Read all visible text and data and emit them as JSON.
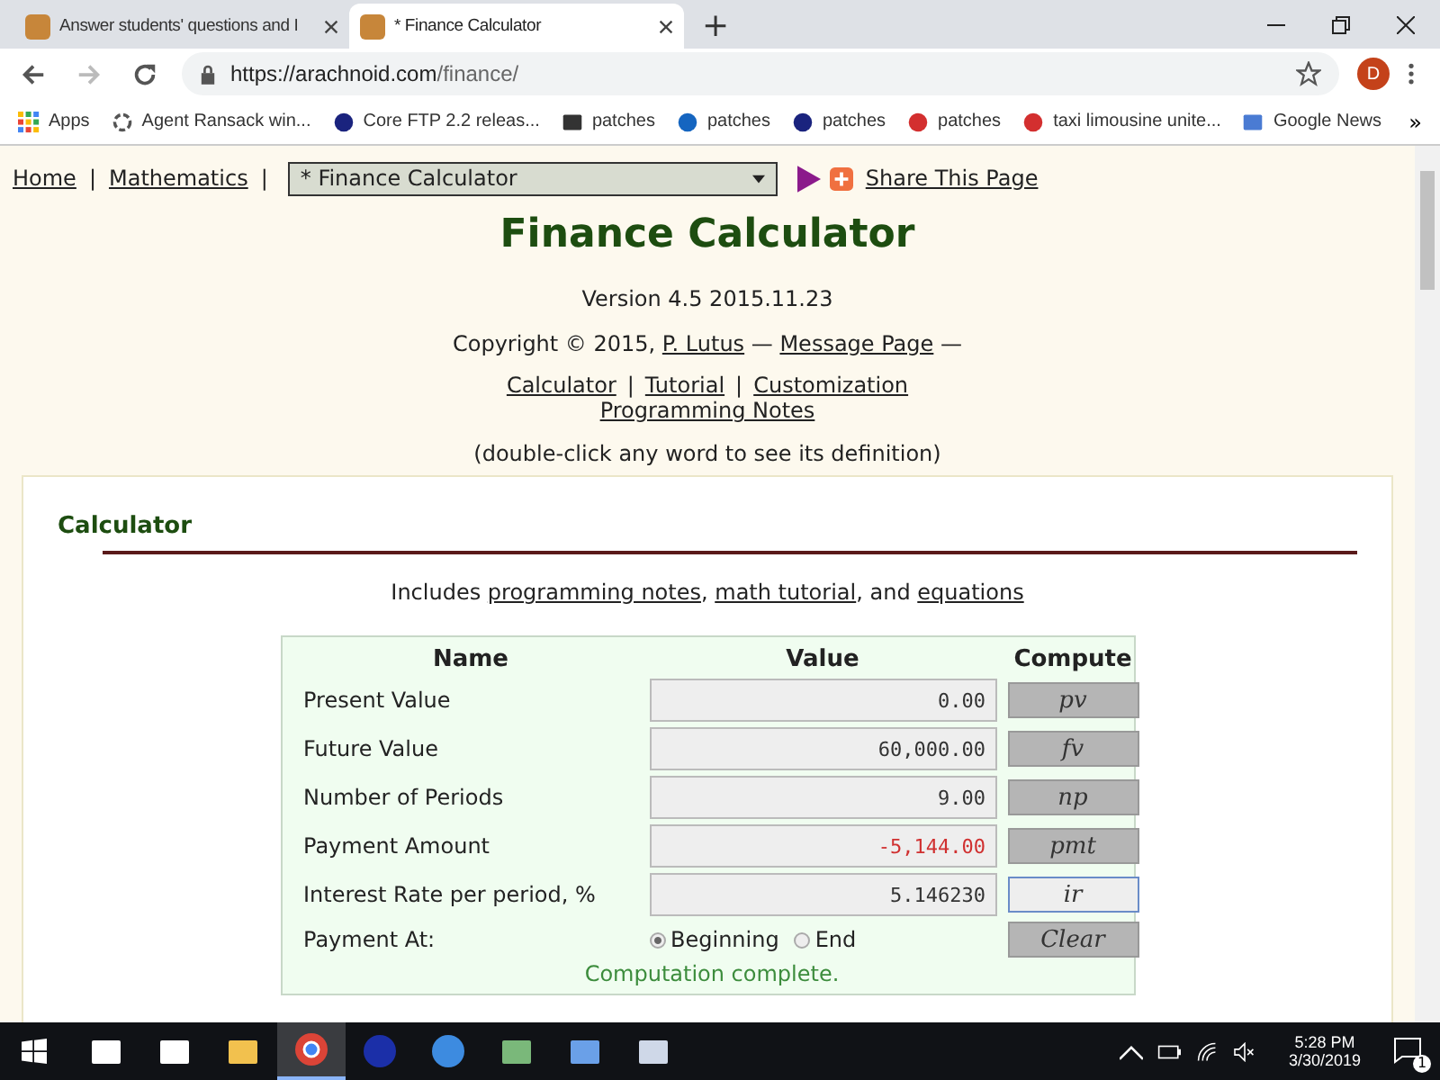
{
  "browser": {
    "tabs": [
      {
        "title": "Answer students' questions and I",
        "selected": false
      },
      {
        "title": "* Finance Calculator",
        "selected": true
      }
    ],
    "new_tab": "+",
    "url_host": "https://arachnoid.com",
    "url_path": "/finance/",
    "profile_initial": "D",
    "bookmarks": [
      {
        "label": "Apps",
        "kind": "grid"
      },
      {
        "label": "Agent Ransack win...",
        "kind": "ring"
      },
      {
        "label": "Core FTP 2.2 releas...",
        "kind": "disc"
      },
      {
        "label": "patches",
        "kind": "square"
      },
      {
        "label": "patches",
        "kind": "drop"
      },
      {
        "label": "patches",
        "kind": "disc"
      },
      {
        "label": "patches",
        "kind": "pin"
      },
      {
        "label": "taxi limousine unite...",
        "kind": "star"
      },
      {
        "label": "Google News",
        "kind": "news"
      }
    ],
    "more": "»"
  },
  "page": {
    "nav": {
      "links": [
        "Home",
        "Mathematics"
      ],
      "separator": "|",
      "dropdown": "* Finance Calculator",
      "share": "Share This Page"
    },
    "title": "Finance Calculator",
    "version": "Version 4.5 2015.11.23",
    "copyright": [
      {
        "text": "Copyright © 2015, ",
        "kind": "text"
      },
      {
        "text": "P. Lutus",
        "kind": "link"
      },
      {
        "text": " — ",
        "kind": "text"
      },
      {
        "text": "Message Page",
        "kind": "link"
      },
      {
        "text": " —",
        "kind": "text"
      }
    ],
    "doc_links": [
      "Calculator",
      "Tutorial",
      "Customization",
      "Programming Notes"
    ],
    "doc_separator": "|",
    "hint": "(double-click any word to see its definition)",
    "section": {
      "heading": "Calculator",
      "includes": [
        {
          "text": "Includes ",
          "kind": "text"
        },
        {
          "text": "programming notes",
          "kind": "link"
        },
        {
          "text": ", ",
          "kind": "text"
        },
        {
          "text": "math tutorial",
          "kind": "link"
        },
        {
          "text": ", and ",
          "kind": "text"
        },
        {
          "text": "equations",
          "kind": "link"
        }
      ],
      "calculator": {
        "columns": [
          "Name",
          "Value",
          "Compute"
        ],
        "rows": [
          {
            "name": "Present Value",
            "value": "0.00",
            "negative": false,
            "button": "pv",
            "focused": false
          },
          {
            "name": "Future Value",
            "value": "60,000.00",
            "negative": false,
            "button": "fv",
            "focused": false
          },
          {
            "name": "Number of Periods",
            "value": "9.00",
            "negative": false,
            "button": "np",
            "focused": false
          },
          {
            "name": "Payment Amount",
            "value": "-5,144.00",
            "negative": true,
            "button": "pmt",
            "focused": false
          },
          {
            "name": "Interest Rate per period, %",
            "value": "5.146230",
            "negative": false,
            "button": "ir",
            "focused": true
          }
        ],
        "payment_at": {
          "label": "Payment At:",
          "options": [
            {
              "label": "Beginning",
              "selected": true
            },
            {
              "label": "End",
              "selected": false
            }
          ]
        },
        "clear": "Clear",
        "status": "Computation complete."
      }
    }
  },
  "taskbar": {
    "apps": [
      {
        "kind": "store",
        "active": false
      },
      {
        "kind": "mail",
        "active": false
      },
      {
        "kind": "folder",
        "active": false
      },
      {
        "kind": "chrome",
        "active": true
      },
      {
        "kind": "feather",
        "active": false
      },
      {
        "kind": "bird",
        "active": false
      },
      {
        "kind": "map",
        "active": false
      },
      {
        "kind": "bot",
        "active": false
      },
      {
        "kind": "pen",
        "active": false
      }
    ],
    "time": "5:28 PM",
    "date": "3/30/2019",
    "notifications": "1"
  }
}
